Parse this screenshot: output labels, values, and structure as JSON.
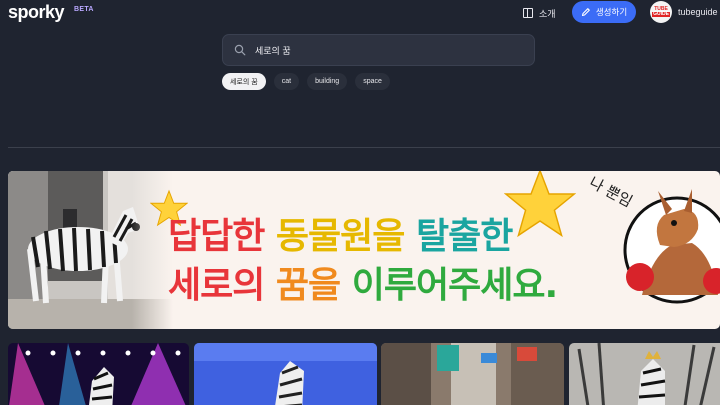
{
  "header": {
    "logo": "sporky",
    "beta": "BETA",
    "about_label": "소개",
    "create_label": "생성하기",
    "avatar_top": "TUBE",
    "avatar_bottom": "GUIDE",
    "username": "tubeguide"
  },
  "search": {
    "value": "세로의 꿈",
    "placeholder": ""
  },
  "chips": [
    {
      "label": "세로의 꿈",
      "active": true
    },
    {
      "label": "cat",
      "active": false
    },
    {
      "label": "building",
      "active": false
    },
    {
      "label": "space",
      "active": false
    }
  ],
  "banner": {
    "line1": [
      "답답한",
      "동물원을",
      "탈출한"
    ],
    "line2": [
      "세로의",
      "꿈을",
      "이루어주세요."
    ],
    "speech": "나 뿐임"
  },
  "thumbnails": [
    {
      "icon": "zebra-concert-thumbnail"
    },
    {
      "icon": "zebra-blue-thumbnail"
    },
    {
      "icon": "zebra-street-thumbnail"
    },
    {
      "icon": "zebra-throne-thumbnail"
    }
  ],
  "colors": {
    "background": "#1f2430",
    "accent": "#3b6cf6",
    "search_bg": "#2d3240"
  }
}
